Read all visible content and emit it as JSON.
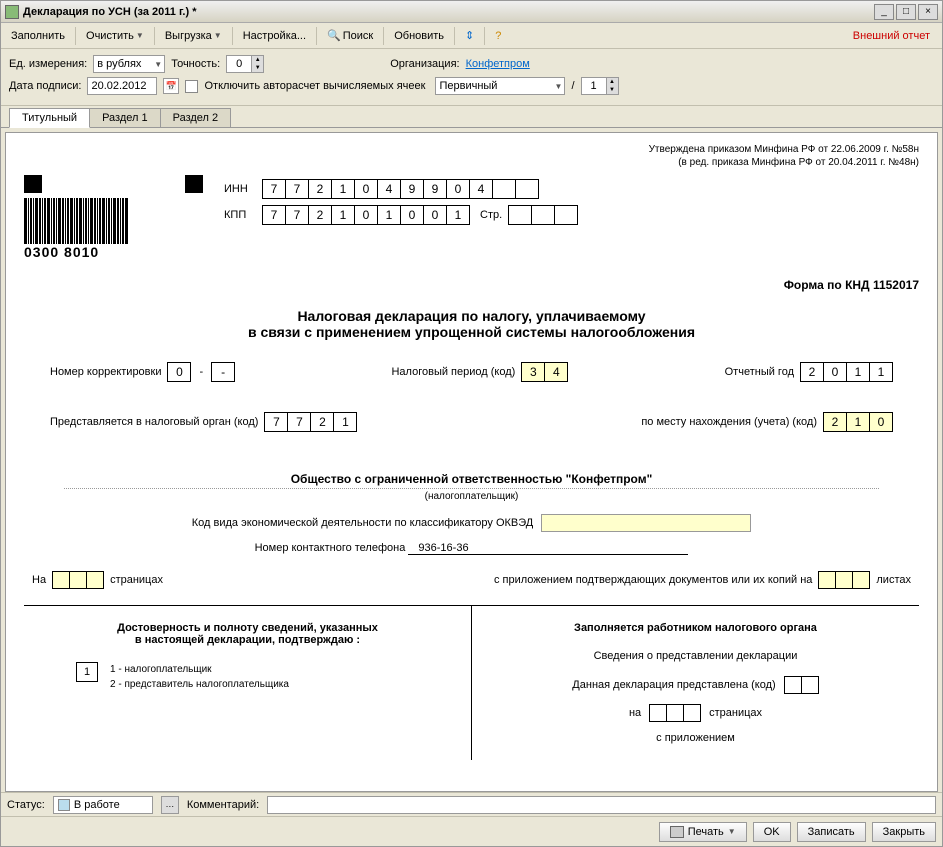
{
  "window": {
    "title": "Декларация по УСН (за 2011 г.) *"
  },
  "toolbar": {
    "fill": "Заполнить",
    "clear": "Очистить",
    "upload": "Выгрузка",
    "settings": "Настройка...",
    "search": "Поиск",
    "refresh": "Обновить",
    "ext_report": "Внешний отчет"
  },
  "params": {
    "unit_label": "Ед. измерения:",
    "unit_value": "в рублях",
    "precision_label": "Точность:",
    "precision_value": "0",
    "org_label": "Организация:",
    "org_value": "Конфетпром",
    "sign_date_label": "Дата подписи:",
    "sign_date_value": "20.02.2012",
    "disable_calc": "Отключить авторасчет вычисляемых ячеек",
    "kind_value": "Первичный",
    "kind_sep": "/",
    "kind_num": "1"
  },
  "tabs": [
    "Титульный",
    "Раздел 1",
    "Раздел 2"
  ],
  "doc": {
    "approval1": "Утверждена приказом Минфина РФ от 22.06.2009 г. №58н",
    "approval2": "(в ред. приказа Минфина РФ от 20.04.2011 г. №48н)",
    "barcode_num": "0300 8010",
    "inn_label": "ИНН",
    "inn": [
      "7",
      "7",
      "2",
      "1",
      "0",
      "4",
      "9",
      "9",
      "0",
      "4",
      "",
      ""
    ],
    "kpp_label": "КПП",
    "kpp": [
      "7",
      "7",
      "2",
      "1",
      "0",
      "1",
      "0",
      "0",
      "1"
    ],
    "str_label": "Стр.",
    "str": [
      "",
      "",
      ""
    ],
    "knd": "Форма по КНД 1152017",
    "title1": "Налоговая декларация по налогу, уплачиваемому",
    "title2": "в связи с применением упрощенной системы налогообложения",
    "corr_label": "Номер корректировки",
    "corr": [
      "0",
      "-",
      "-"
    ],
    "period_label": "Налоговый период (код)",
    "period": [
      "3",
      "4"
    ],
    "year_label": "Отчетный год",
    "year": [
      "2",
      "0",
      "1",
      "1"
    ],
    "organ_label": "Представляется в налоговый орган (код)",
    "organ": [
      "7",
      "7",
      "2",
      "1"
    ],
    "place_label": "по месту нахождения (учета) (код)",
    "place": [
      "2",
      "1",
      "0"
    ],
    "org_full": "Общество с ограниченной ответственностью \"Конфетпром\"",
    "org_sub": "(налогоплательщик)",
    "okved_label": "Код вида экономической деятельности по классификатору ОКВЭД",
    "phone_label": "Номер контактного телефона",
    "phone": "936-16-36",
    "on_label": "На",
    "pages_label": "страницах",
    "attach_label": "с приложением подтверждающих документов или их копий на",
    "sheets_label": "листах",
    "left_h1": "Достоверность и полноту сведений, указанных",
    "left_h2": "в настоящей декларации, подтверждаю :",
    "conf_value": "1",
    "conf_opt1": "1 - налогоплательщик",
    "conf_opt2": "2 - представитель налогоплательщика",
    "right_h": "Заполняется работником налогового органа",
    "right_sub": "Сведения о представлении декларации",
    "right_l1": "Данная декларация представлена (код)",
    "right_on": "на",
    "right_pages": "страницах",
    "right_attach": "с приложением"
  },
  "status": {
    "label": "Статус:",
    "value": "В работе",
    "comment_label": "Комментарий:"
  },
  "bottom": {
    "print": "Печать",
    "ok": "OK",
    "save": "Записать",
    "close": "Закрыть"
  }
}
